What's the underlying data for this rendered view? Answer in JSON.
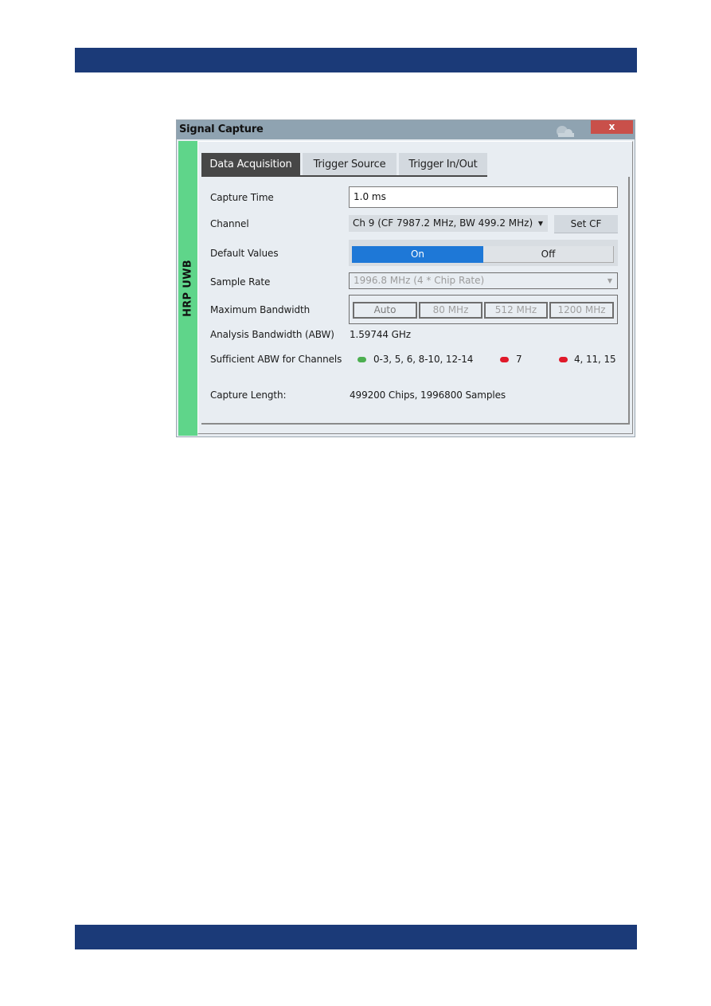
{
  "page": {
    "header_bar_color": "#1b3a78",
    "footer_bar_color": "#1b3a78"
  },
  "dialog": {
    "title": "Signal Capture",
    "close_label": "x",
    "side_label": "HRP UWB",
    "side_color": "#5fd58a",
    "tabs": [
      {
        "label": "Data Acquisition",
        "active": true
      },
      {
        "label": "Trigger Source",
        "active": false
      },
      {
        "label": "Trigger In/Out",
        "active": false
      }
    ],
    "capture_time": {
      "label": "Capture Time",
      "value": "1.0 ms"
    },
    "channel": {
      "label": "Channel",
      "value": "Ch 9 (CF 7987.2 MHz, BW 499.2 MHz)",
      "button": "Set CF"
    },
    "default_values": {
      "label": "Default Values",
      "on": "On",
      "off": "Off",
      "selected": "On"
    },
    "sample_rate": {
      "label": "Sample Rate",
      "value": "1996.8 MHz (4 * Chip Rate)"
    },
    "max_bandwidth": {
      "label": "Maximum Bandwidth",
      "options": [
        "Auto",
        "80 MHz",
        "512 MHz",
        "1200 MHz"
      ],
      "selected": "Auto"
    },
    "analysis_bandwidth": {
      "label": "Analysis Bandwidth (ABW)",
      "value": "1.59744 GHz"
    },
    "sufficient_abw": {
      "label": "Sufficient ABW for Channels",
      "groups": [
        {
          "status": "green",
          "channels": "0-3, 5, 6, 8-10, 12-14"
        },
        {
          "status": "red",
          "channels": "7"
        },
        {
          "status": "red",
          "channels": "4, 11, 15"
        }
      ]
    },
    "capture_length": {
      "label": "Capture Length:",
      "value": "499200 Chips, 1996800 Samples"
    }
  }
}
